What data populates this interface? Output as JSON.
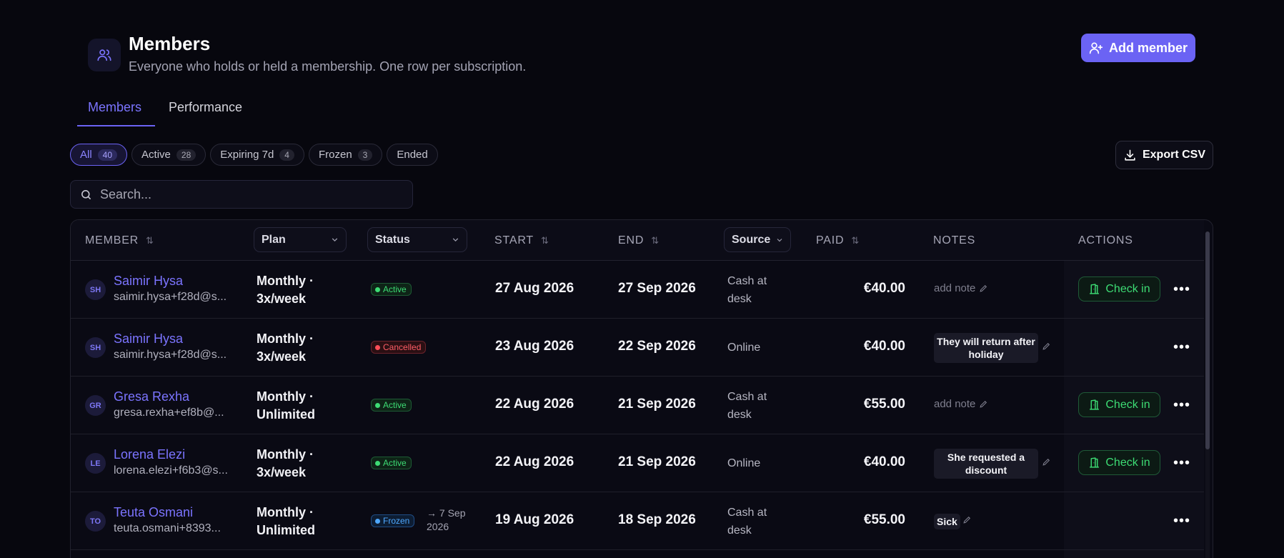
{
  "header": {
    "title": "Members",
    "subtitle": "Everyone who holds or held a membership. One row per subscription.",
    "icon": "users-icon",
    "add_member_label": "Add member"
  },
  "tabs": [
    {
      "label": "Members",
      "active": true
    },
    {
      "label": "Performance",
      "active": false
    }
  ],
  "filters": [
    {
      "label": "All",
      "count": "40",
      "active": true
    },
    {
      "label": "Active",
      "count": "28",
      "active": false
    },
    {
      "label": "Expiring 7d",
      "count": "4",
      "active": false
    },
    {
      "label": "Frozen",
      "count": "3",
      "active": false
    },
    {
      "label": "Ended",
      "count": "",
      "active": false
    }
  ],
  "export_label": "Export CSV",
  "search": {
    "placeholder": "Search...",
    "value": ""
  },
  "columns": {
    "member": "MEMBER",
    "plan": "Plan",
    "status": "Status",
    "start": "START",
    "end": "END",
    "source": "Source",
    "paid": "PAID",
    "notes": "NOTES",
    "actions": "ACTIONS"
  },
  "rows": [
    {
      "initials": "SH",
      "name": "Saimir Hysa",
      "email": "saimir.hysa+f28d@s...",
      "plan": "Monthly · 3x/week",
      "status": "Active",
      "status_kind": "active",
      "status_extra": "",
      "start": "27 Aug 2026",
      "end": "27 Sep 2026",
      "source": "Cash at desk",
      "paid": "€40.00",
      "note": "",
      "note_placeholder": "add note",
      "checkin": "Check in"
    },
    {
      "initials": "SH",
      "name": "Saimir Hysa",
      "email": "saimir.hysa+f28d@s...",
      "plan": "Monthly · 3x/week",
      "status": "Cancelled",
      "status_kind": "cancelled",
      "status_extra": "",
      "start": "23 Aug 2026",
      "end": "22 Sep 2026",
      "source": "Online",
      "paid": "€40.00",
      "note": "They will return after holiday",
      "note_placeholder": "",
      "checkin": ""
    },
    {
      "initials": "GR",
      "name": "Gresa Rexha",
      "email": "gresa.rexha+ef8b@...",
      "plan": "Monthly · Unlimited",
      "status": "Active",
      "status_kind": "active",
      "status_extra": "",
      "start": "22 Aug 2026",
      "end": "21 Sep 2026",
      "source": "Cash at desk",
      "paid": "€55.00",
      "note": "",
      "note_placeholder": "add note",
      "checkin": "Check in"
    },
    {
      "initials": "LE",
      "name": "Lorena Elezi",
      "email": "lorena.elezi+f6b3@s...",
      "plan": "Monthly · 3x/week",
      "status": "Active",
      "status_kind": "active",
      "status_extra": "",
      "start": "22 Aug 2026",
      "end": "21 Sep 2026",
      "source": "Online",
      "paid": "€40.00",
      "note": "She requested a discount",
      "note_placeholder": "",
      "checkin": "Check in"
    },
    {
      "initials": "TO",
      "name": "Teuta Osmani",
      "email": "teuta.osmani+8393...",
      "plan": "Monthly · Unlimited",
      "status": "Frozen",
      "status_kind": "frozen",
      "status_extra": "→ 7 Sep 2026",
      "start": "19 Aug 2026",
      "end": "18 Sep 2026",
      "source": "Cash at desk",
      "paid": "€55.00",
      "note": "Sick",
      "note_placeholder": "",
      "checkin": ""
    }
  ],
  "colors": {
    "accent": "#6b63f4",
    "background": "#07070e",
    "active": "#3ddc74",
    "cancelled": "#ff5d66",
    "frozen": "#4ea8ff"
  }
}
